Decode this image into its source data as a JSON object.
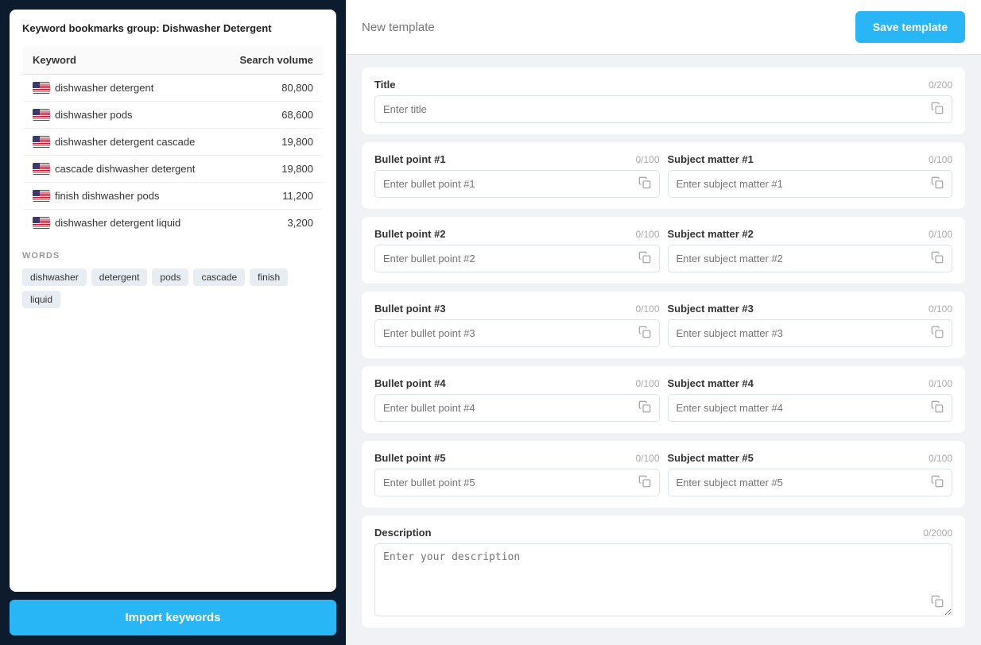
{
  "left": {
    "group_label": "Keyword bookmarks group:",
    "group_name": "Dishwasher Detergent",
    "table": {
      "col_keyword": "Keyword",
      "col_volume": "Search volume",
      "rows": [
        {
          "keyword": "dishwasher detergent",
          "volume": "80,800"
        },
        {
          "keyword": "dishwasher pods",
          "volume": "68,600"
        },
        {
          "keyword": "dishwasher detergent cascade",
          "volume": "19,800"
        },
        {
          "keyword": "cascade dishwasher detergent",
          "volume": "19,800"
        },
        {
          "keyword": "finish dishwasher pods",
          "volume": "11,200"
        },
        {
          "keyword": "dishwasher detergent liquid",
          "volume": "3,200"
        }
      ]
    },
    "words_label": "WORDS",
    "words": [
      "dishwasher",
      "detergent",
      "pods",
      "cascade",
      "finish",
      "liquid"
    ],
    "import_btn": "Import keywords"
  },
  "right": {
    "header": {
      "template_name_placeholder": "New template",
      "save_btn": "Save template"
    },
    "title": {
      "label": "Title",
      "count": "0/200",
      "placeholder": "Enter title"
    },
    "bullet_points": [
      {
        "bp_label": "Bullet point #1",
        "bp_count": "0/100",
        "bp_placeholder": "Enter bullet point #1",
        "sm_label": "Subject matter #1",
        "sm_count": "0/100",
        "sm_placeholder": "Enter subject matter #1"
      },
      {
        "bp_label": "Bullet point #2",
        "bp_count": "0/100",
        "bp_placeholder": "Enter bullet point #2",
        "sm_label": "Subject matter #2",
        "sm_count": "0/100",
        "sm_placeholder": "Enter subject matter #2"
      },
      {
        "bp_label": "Bullet point #3",
        "bp_count": "0/100",
        "bp_placeholder": "Enter bullet point #3",
        "sm_label": "Subject matter #3",
        "sm_count": "0/100",
        "sm_placeholder": "Enter subject matter #3"
      },
      {
        "bp_label": "Bullet point #4",
        "bp_count": "0/100",
        "bp_placeholder": "Enter bullet point #4",
        "sm_label": "Subject matter #4",
        "sm_count": "0/100",
        "sm_placeholder": "Enter subject matter #4"
      },
      {
        "bp_label": "Bullet point #5",
        "bp_count": "0/100",
        "bp_placeholder": "Enter bullet point #5",
        "sm_label": "Subject matter #5",
        "sm_count": "0/100",
        "sm_placeholder": "Enter subject matter #5"
      }
    ],
    "description": {
      "label": "Description",
      "count": "0/2000",
      "placeholder": "Enter your description"
    }
  }
}
